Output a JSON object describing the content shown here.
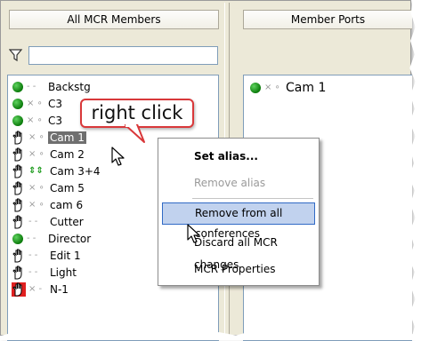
{
  "left_panel": {
    "header": "All MCR Members",
    "filter_placeholder": "",
    "members": [
      {
        "icon": "green-dot-icon",
        "marks": "- -",
        "label": "Backstg"
      },
      {
        "icon": "green-dot-icon",
        "marks": "× ∘",
        "label": "C3"
      },
      {
        "icon": "green-dot-icon",
        "marks": "× ∘",
        "label": "C3"
      },
      {
        "icon": "raised-hand-icon",
        "marks": "× ∘",
        "label": "Cam 1",
        "selected": true
      },
      {
        "icon": "raised-hand-icon",
        "marks": "× ∘",
        "label": "Cam 2"
      },
      {
        "icon": "raised-hand-icon",
        "marks": "⇕⇕",
        "label": "Cam 3+4"
      },
      {
        "icon": "raised-hand-icon",
        "marks": "× ∘",
        "label": "Cam 5"
      },
      {
        "icon": "raised-hand-icon",
        "marks": "× ∘",
        "label": "cam 6"
      },
      {
        "icon": "raised-hand-icon",
        "marks": "- -",
        "label": "Cutter"
      },
      {
        "icon": "green-dot-icon",
        "marks": "- -",
        "label": "Director"
      },
      {
        "icon": "raised-hand-icon",
        "marks": "- -",
        "label": "Edit 1"
      },
      {
        "icon": "raised-hand-icon",
        "marks": "- -",
        "label": "Light"
      },
      {
        "icon": "raised-hand-red-icon",
        "marks": "× -",
        "label": "N-1"
      }
    ]
  },
  "right_panel": {
    "header": "Member Ports",
    "ports": [
      {
        "icon": "green-dot-icon",
        "marks": "× ∘",
        "label": "Cam 1"
      }
    ]
  },
  "callout": {
    "text": "right click"
  },
  "context_menu": {
    "items": [
      {
        "label": "Set alias...",
        "style": "bold"
      },
      {
        "label": "Remove alias",
        "style": "disabled"
      },
      {
        "label": "Remove from all conferences",
        "style": "highlighted"
      },
      {
        "label": "Discard all MCR changes",
        "style": "normal"
      },
      {
        "label": "MCR Properties",
        "style": "normal"
      }
    ]
  },
  "colors": {
    "selection": "#6f6f6f",
    "menu_highlight": "#c1d2ee",
    "menu_highlight_border": "#316ac5",
    "callout_border": "#d9383a",
    "status_green": "#0a7a0a"
  }
}
